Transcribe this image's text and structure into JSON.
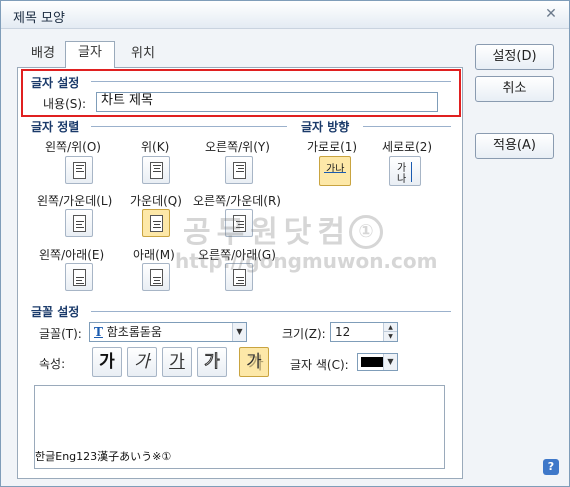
{
  "window": {
    "title": "제목 모양",
    "close_symbol": "✕"
  },
  "tabs": [
    {
      "label": "배경"
    },
    {
      "label": "글자"
    },
    {
      "label": "위치"
    }
  ],
  "side_buttons": {
    "set": "설정(D)",
    "cancel": "취소",
    "apply": "적용(A)"
  },
  "text_settings": {
    "section_title": "글자 설정",
    "content_label": "내용(S):",
    "content_value": "차트 제목"
  },
  "alignment": {
    "section_title": "글자 정렬",
    "options": [
      {
        "label": "왼쪽/위(O)"
      },
      {
        "label": "위(K)"
      },
      {
        "label": "오른쪽/위(Y)"
      },
      {
        "label": "왼쪽/가운데(L)"
      },
      {
        "label": "가운데(Q)"
      },
      {
        "label": "오른쪽/가운데(R)"
      },
      {
        "label": "왼쪽/아래(E)"
      },
      {
        "label": "아래(M)"
      },
      {
        "label": "오른쪽/아래(G)"
      }
    ],
    "selected": "가운데(Q)"
  },
  "direction": {
    "section_title": "글자 방향",
    "horizontal_label": "가로로(1)",
    "vertical_label": "세로로(2)",
    "horizontal_glyph": "가나",
    "vertical_glyph_top": "가",
    "vertical_glyph_bottom": "나"
  },
  "font": {
    "section_title": "글꼴 설정",
    "font_label": "글꼴(T):",
    "font_value": "함초롬돋움",
    "font_type_glyph": "T",
    "size_label": "크기(Z):",
    "size_value": "12",
    "attr_label": "속성:",
    "attributes": [
      {
        "name": "bold",
        "glyph": "가"
      },
      {
        "name": "italic",
        "glyph": "가"
      },
      {
        "name": "underline",
        "glyph": "가"
      },
      {
        "name": "outline",
        "glyph": "가"
      },
      {
        "name": "shadow",
        "glyph": "가"
      }
    ],
    "color_label": "글자 색(C):",
    "color_value": "#000000"
  },
  "preview": {
    "text": "한글Eng123漢子あいう※①"
  },
  "watermark": {
    "line1": "공무원닷컴",
    "line2": "http://gongmuwon.com",
    "badge": "①"
  },
  "help": {
    "symbol": "?"
  }
}
